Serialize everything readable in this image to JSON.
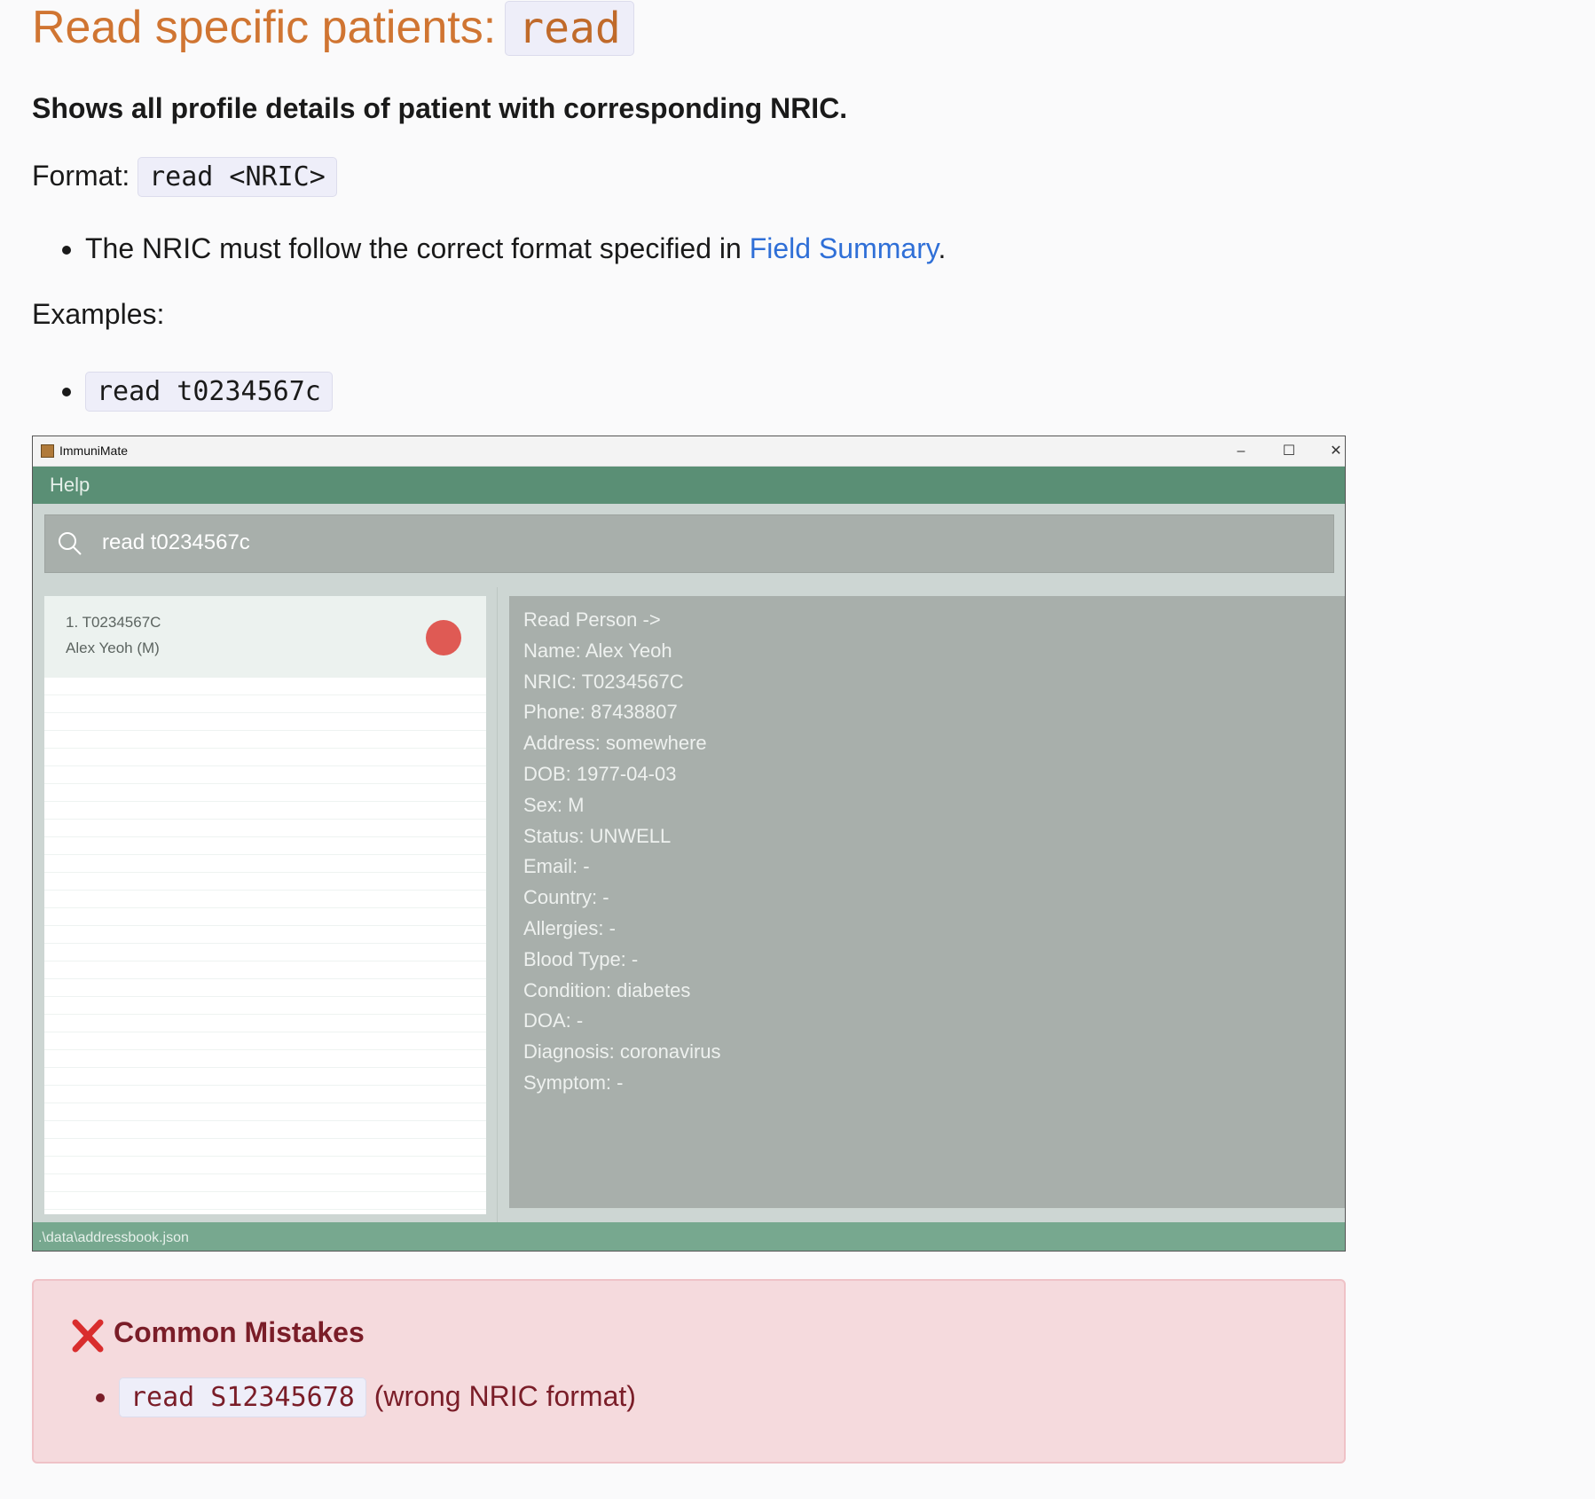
{
  "heading": {
    "text": "Read specific patients:",
    "code": "read"
  },
  "lead": "Shows all profile details of patient with corresponding NRIC.",
  "format": {
    "label": "Format:",
    "code": "read <NRIC>"
  },
  "note": {
    "before": "The NRIC must follow the correct format specified in ",
    "link": "Field Summary",
    "after": "."
  },
  "examples": {
    "label": "Examples:",
    "items": [
      "read t0234567c"
    ]
  },
  "app": {
    "window_title": "ImmuniMate",
    "controls": {
      "minimize": "–",
      "maximize": "☐",
      "close": "✕"
    },
    "menu": {
      "help": "Help"
    },
    "command_input": "read t0234567c",
    "list": [
      {
        "id_line": "1.  T0234567C",
        "name_line": "Alex Yeoh (M)",
        "status_color": "#df5a54"
      }
    ],
    "details": [
      "Read Person ->",
      "Name: Alex Yeoh",
      "NRIC: T0234567C",
      "Phone: 87438807",
      "Address: somewhere",
      "DOB: 1977-04-03",
      "Sex: M",
      "Status: UNWELL",
      "Email: -",
      "Country: -",
      "Allergies: -",
      "Blood Type: -",
      "Condition: diabetes",
      "DOA: -",
      "Diagnosis: coronavirus",
      "Symptom: -"
    ],
    "status_path": ".\\data\\addressbook.json"
  },
  "mistakes": {
    "title": "Common Mistakes",
    "items": [
      {
        "code": "read S12345678",
        "note": "(wrong NRIC format)"
      }
    ]
  }
}
